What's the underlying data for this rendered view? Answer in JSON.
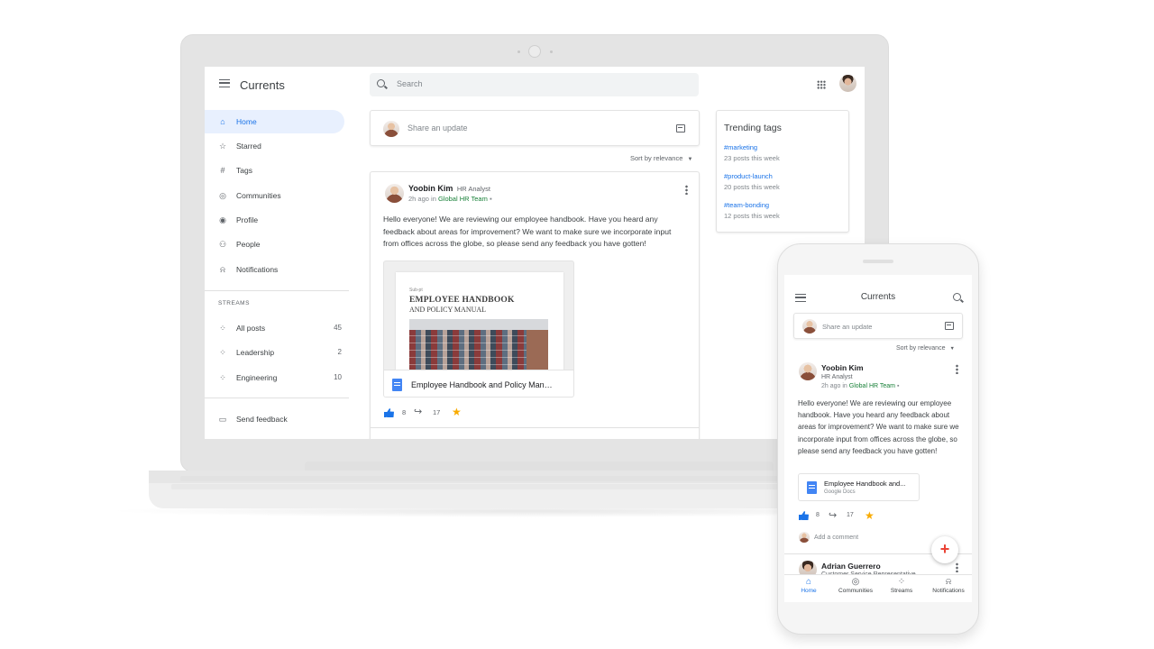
{
  "desktop": {
    "app_title": "Currents",
    "search_placeholder": "Search",
    "nav": [
      {
        "label": "Home",
        "icon": "home-icon",
        "active": true
      },
      {
        "label": "Starred",
        "icon": "star-outline-icon"
      },
      {
        "label": "Tags",
        "icon": "hashtag-icon"
      },
      {
        "label": "Communities",
        "icon": "communities-icon"
      },
      {
        "label": "Profile",
        "icon": "profile-icon"
      },
      {
        "label": "People",
        "icon": "people-icon"
      },
      {
        "label": "Notifications",
        "icon": "bell-icon"
      }
    ],
    "streams_label": "STREAMS",
    "streams": [
      {
        "label": "All posts",
        "count": "45",
        "icon": "stream-icon"
      },
      {
        "label": "Leadership",
        "count": "2",
        "icon": "stream-icon"
      },
      {
        "label": "Engineering",
        "count": "10",
        "icon": "stream-icon"
      }
    ],
    "send_feedback": "Send feedback",
    "share_placeholder": "Share an update",
    "sort_label": "Sort by relevance",
    "post": {
      "author": "Yoobin Kim",
      "role": "HR Analyst",
      "time": "2h ago in",
      "group": "Global HR Team",
      "body": "Hello everyone! We are reviewing our employee handbook. Have you heard any feedback about areas for improvement? We want to make sure we incorporate input from offices across the globe, so please send any feedback you have gotten!",
      "doc_kicker": "Sub-pt",
      "doc_heading_1": "EMPLOYEE HANDBOOK",
      "doc_heading_2": "AND POLICY MANUAL",
      "attachment_title": "Employee Handbook and Policy Man…",
      "likes": "8",
      "shares": "17"
    },
    "trending": {
      "title": "Trending tags",
      "tags": [
        {
          "tag": "#marketing",
          "meta": "23 posts this week"
        },
        {
          "tag": "#product-launch",
          "meta": "20 posts this week"
        },
        {
          "tag": "#team-bonding",
          "meta": "12 posts this week"
        }
      ]
    }
  },
  "mobile": {
    "app_title": "Currents",
    "share_placeholder": "Share an update",
    "sort_label": "Sort by relevance",
    "post": {
      "author": "Yoobin Kim",
      "role": "HR Analyst",
      "time": "2h ago in",
      "group": "Global HR Team",
      "body": "Hello everyone! We are reviewing our employee handbook. Have you heard any feedback about areas for improvement? We want to make sure we incorporate input from offices across the globe, so please send any feedback you have gotten!",
      "attachment_title": "Employee Handbook and...",
      "attachment_sub": "Google Docs",
      "likes": "8",
      "shares": "17",
      "comment_placeholder": "Add a comment"
    },
    "next_post_author": "Adrian Guerrero",
    "next_post_role": "Customer Service Representative",
    "bottom_nav": [
      {
        "label": "Home",
        "active": true
      },
      {
        "label": "Communities"
      },
      {
        "label": "Streams"
      },
      {
        "label": "Notifications"
      }
    ]
  },
  "colors": {
    "accent": "#1a73e8",
    "group_green": "#188038",
    "star": "#f9ab00",
    "active_nav_bg": "#e8f0fe"
  }
}
